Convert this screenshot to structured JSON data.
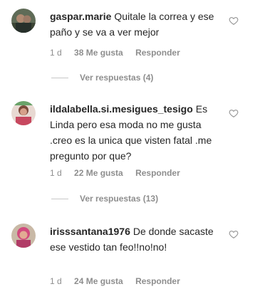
{
  "comments": [
    {
      "username": "gaspar.marie",
      "text": "Quitale la correa y ese paño y se va a ver mejor",
      "age": "1 d",
      "likes": "38 Me gusta",
      "reply_label": "Responder",
      "replies_label": "Ver respuestas (4)"
    },
    {
      "username": "ildalabella.si.mesigues_tesigo",
      "text": "Es Linda pero esa moda no me gusta .creo es la unica que visten fatal .me pregunto por que?",
      "age": "1 d",
      "likes": "22 Me gusta",
      "reply_label": "Responder",
      "replies_label": "Ver respuestas (13)"
    },
    {
      "username": "irisssantana1976",
      "text": "De donde sacaste ese vestido tan feo!!no!no!",
      "age": "1 d",
      "likes": "24 Me gusta",
      "reply_label": "Responder"
    }
  ],
  "colors": {
    "text": "#262626",
    "secondary": "#8e8e8e",
    "divider": "#c7c7c7"
  }
}
